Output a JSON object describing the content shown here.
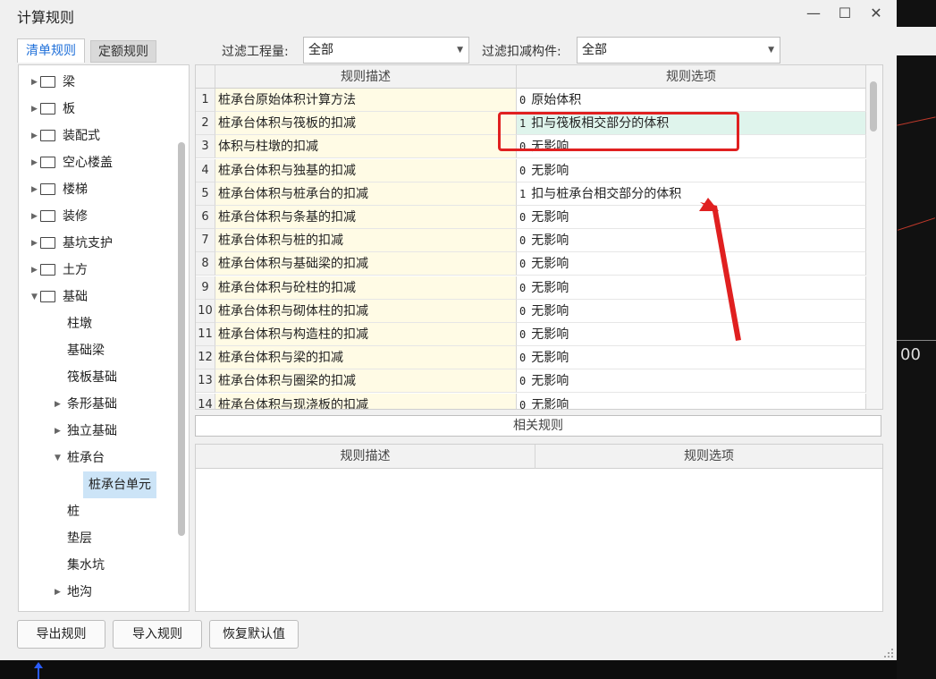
{
  "window": {
    "title": "计算规则",
    "controls": {
      "minimize": "—",
      "maximize": "☐",
      "close": "✕"
    }
  },
  "tabs": [
    {
      "label": "清单规则",
      "active": true
    },
    {
      "label": "定额规则",
      "active": false
    }
  ],
  "filters": {
    "quantity_label": "过滤工程量:",
    "quantity_value": "全部",
    "component_label": "过滤扣减构件:",
    "component_value": "全部"
  },
  "tree": {
    "top_items": [
      {
        "label": "梁"
      },
      {
        "label": "板"
      },
      {
        "label": "装配式"
      },
      {
        "label": "空心楼盖"
      },
      {
        "label": "楼梯"
      },
      {
        "label": "装修"
      },
      {
        "label": "基坑支护"
      },
      {
        "label": "土方"
      },
      {
        "label": "基础"
      }
    ],
    "foundation_children": [
      {
        "label": "柱墩",
        "expandable": false
      },
      {
        "label": "基础梁",
        "expandable": false
      },
      {
        "label": "筏板基础",
        "expandable": false
      },
      {
        "label": "条形基础",
        "expandable": true
      },
      {
        "label": "独立基础",
        "expandable": true
      },
      {
        "label": "桩承台",
        "expandable": true,
        "expanded": true
      }
    ],
    "pile_cap_child": "桩承台单元",
    "rest_items": [
      {
        "label": "桩",
        "expandable": false
      },
      {
        "label": "垫层",
        "expandable": false
      },
      {
        "label": "集水坑",
        "expandable": false
      },
      {
        "label": "地沟",
        "expandable": true
      }
    ]
  },
  "rules_grid": {
    "headers": {
      "description": "规则描述",
      "option": "规则选项"
    },
    "rows": [
      {
        "num": "1",
        "description": "桩承台原始体积计算方法",
        "option_value": "0",
        "option_text": "原始体积"
      },
      {
        "num": "2",
        "description": "桩承台体积与筏板的扣减",
        "option_value": "1",
        "option_text": "扣与筏板相交部分的体积"
      },
      {
        "num": "3",
        "description": "体积与柱墩的扣减",
        "option_value": "0",
        "option_text": "无影响"
      },
      {
        "num": "4",
        "description": "桩承台体积与独基的扣减",
        "option_value": "0",
        "option_text": "无影响"
      },
      {
        "num": "5",
        "description": "桩承台体积与桩承台的扣减",
        "option_value": "1",
        "option_text": "扣与桩承台相交部分的体积"
      },
      {
        "num": "6",
        "description": "桩承台体积与条基的扣减",
        "option_value": "0",
        "option_text": "无影响"
      },
      {
        "num": "7",
        "description": "桩承台体积与桩的扣减",
        "option_value": "0",
        "option_text": "无影响"
      },
      {
        "num": "8",
        "description": "桩承台体积与基础梁的扣减",
        "option_value": "0",
        "option_text": "无影响"
      },
      {
        "num": "9",
        "description": "桩承台体积与砼柱的扣减",
        "option_value": "0",
        "option_text": "无影响"
      },
      {
        "num": "10",
        "description": "桩承台体积与砌体柱的扣减",
        "option_value": "0",
        "option_text": "无影响"
      },
      {
        "num": "11",
        "description": "桩承台体积与构造柱的扣减",
        "option_value": "0",
        "option_text": "无影响"
      },
      {
        "num": "12",
        "description": "桩承台体积与梁的扣减",
        "option_value": "0",
        "option_text": "无影响"
      },
      {
        "num": "13",
        "description": "桩承台体积与圈梁的扣减",
        "option_value": "0",
        "option_text": "无影响"
      },
      {
        "num": "14",
        "description": "桩承台体积与现浇板的扣减",
        "option_value": "0",
        "option_text": "无影响"
      }
    ]
  },
  "related_rules": {
    "bar_label": "相关规则",
    "headers": {
      "description": "规则描述",
      "option": "规则选项"
    }
  },
  "buttons": {
    "export": "导出规则",
    "import": "导入规则",
    "restore": "恢复默认值"
  },
  "background": {
    "overlay_text": "00"
  },
  "colors": {
    "accent_tab": "#1e6fd9",
    "annotation_red": "#e02020",
    "description_bg": "#fffbe5",
    "highlight_row": "#dff4ec",
    "tree_selected": "#cce4f7"
  }
}
